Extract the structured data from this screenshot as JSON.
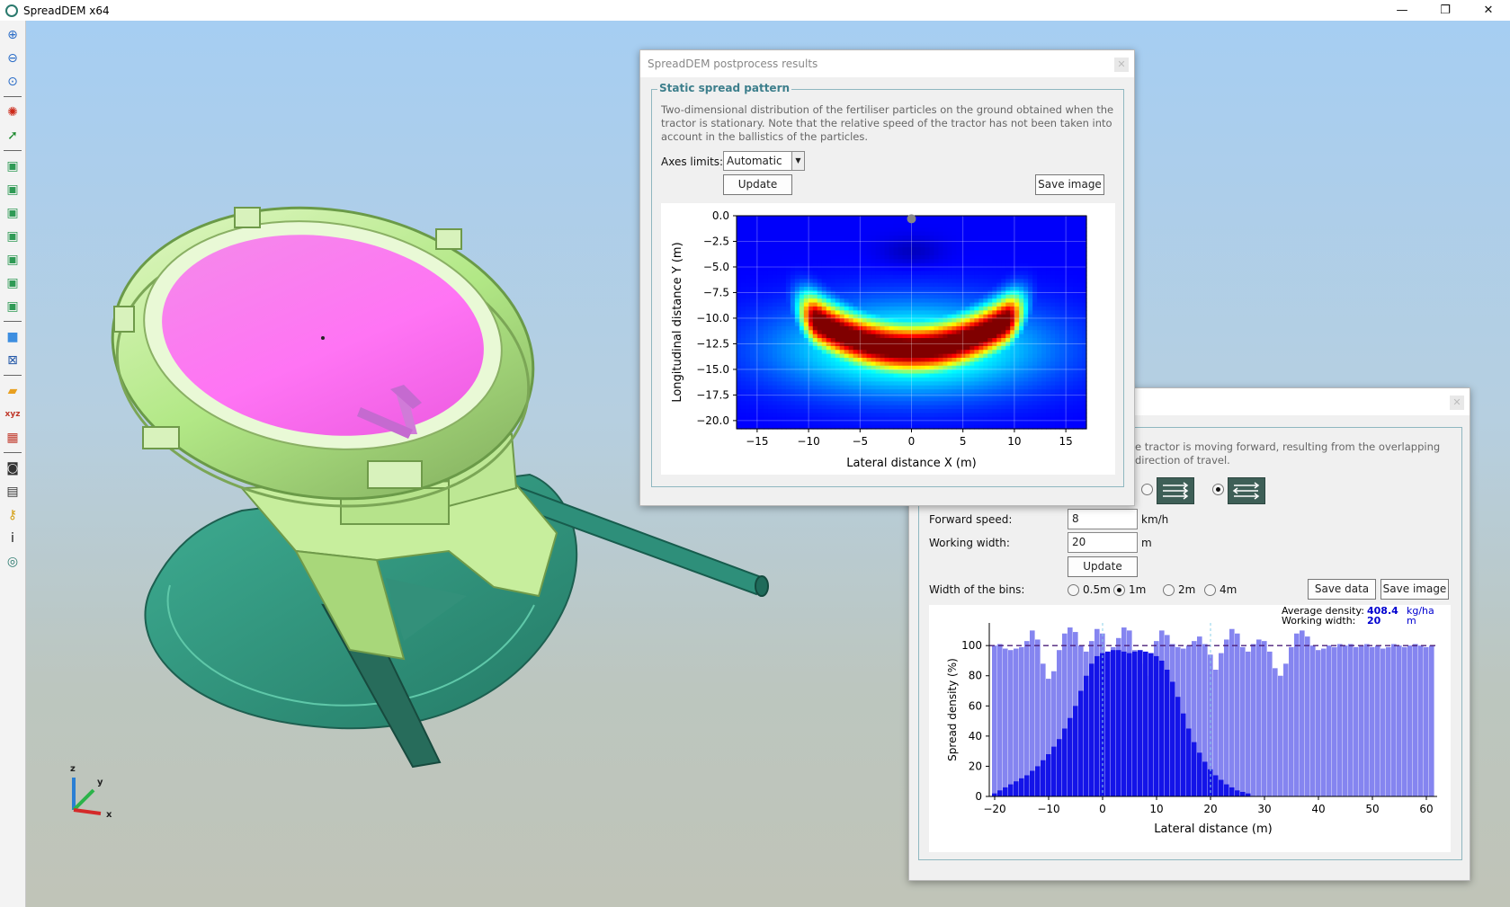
{
  "app": {
    "title": "SpreadDEM x64"
  },
  "window_controls": {
    "minimize": "—",
    "restore": "❐",
    "close": "✕"
  },
  "toolbar": [
    {
      "name": "zoom-in-icon",
      "glyph": "⊕",
      "color": "#2a6cc7"
    },
    {
      "name": "zoom-out-icon",
      "glyph": "⊖",
      "color": "#2a6cc7"
    },
    {
      "name": "zoom-fit-icon",
      "glyph": "⊙",
      "color": "#2a6cc7"
    },
    {
      "name": "rotate-view-icon",
      "glyph": "✺",
      "color": "#cc2a1a"
    },
    {
      "name": "pick-icon",
      "glyph": "➚",
      "color": "#1d8a2f"
    },
    {
      "name": "view-front-icon",
      "glyph": "▣",
      "color": "#2f9a55"
    },
    {
      "name": "view-back-icon",
      "glyph": "▣",
      "color": "#2f9a55"
    },
    {
      "name": "view-left-icon",
      "glyph": "▣",
      "color": "#2f9a55"
    },
    {
      "name": "view-right-icon",
      "glyph": "▣",
      "color": "#2f9a55"
    },
    {
      "name": "view-top-icon",
      "glyph": "▣",
      "color": "#2f9a55"
    },
    {
      "name": "view-bottom-icon",
      "glyph": "▣",
      "color": "#2f9a55"
    },
    {
      "name": "view-iso-icon",
      "glyph": "▣",
      "color": "#2f9a55"
    },
    {
      "name": "shaded-mode-icon",
      "glyph": "■",
      "color": "#3d8ee0"
    },
    {
      "name": "wireframe-mode-icon",
      "glyph": "⊠",
      "color": "#2458a8"
    },
    {
      "name": "measure-icon",
      "glyph": "▰",
      "color": "#e8a020"
    },
    {
      "name": "axes-icon",
      "glyph": "xyz",
      "color": "#c0392b"
    },
    {
      "name": "chart-icon",
      "glyph": "▦",
      "color": "#c0392b"
    },
    {
      "name": "camera-icon",
      "glyph": "◙",
      "color": "#333333"
    },
    {
      "name": "print-icon",
      "glyph": "▤",
      "color": "#333333"
    },
    {
      "name": "key-icon",
      "glyph": "⚷",
      "color": "#d4a017"
    },
    {
      "name": "info-icon",
      "glyph": "i",
      "color": "#111111"
    },
    {
      "name": "spreadem-logo-icon",
      "glyph": "◎",
      "color": "#2b7a6e"
    }
  ],
  "axis_triad": {
    "z": "z",
    "y": "y",
    "x": "x"
  },
  "dialog1": {
    "title": "SpreadDEM postprocess results",
    "close": "✕",
    "group_title": "Static spread pattern",
    "description": "Two-dimensional distribution of the fertiliser particles on the ground obtained when the tractor is stationary. Note that the relative speed of the tractor has not been taken into account in the ballistics of the particles.",
    "axes_limits_label": "Axes limits:",
    "axes_limits_value": "Automatic",
    "update_label": "Update",
    "save_image_label": "Save image"
  },
  "dialog2": {
    "close": "✕",
    "description": "e tractor is moving forward, resulting from the overlapping\ndirection of travel.",
    "forward_speed_label": "Forward speed:",
    "forward_speed_value": "8",
    "forward_speed_unit": "km/h",
    "working_width_label": "Working width:",
    "working_width_value": "20",
    "working_width_unit": "m",
    "update_label": "Update",
    "bins_label": "Width of the bins:",
    "bin_options": [
      "0.5m",
      "1m",
      "2m",
      "4m"
    ],
    "bin_selected": "1m",
    "save_data_label": "Save data",
    "save_image_label": "Save image"
  },
  "colors": {
    "heatmap_bg": "#0a0ad8",
    "bar_light": "#8585f0",
    "bar_dark": "#1414e8",
    "accent_text": "#0000d0",
    "dashed_line": "#4b1f7a"
  },
  "chart_data": [
    {
      "type": "heatmap",
      "title": "",
      "xlabel": "Lateral distance X (m)",
      "ylabel": "Longitudinal distance Y (m)",
      "xlim": [
        -17,
        17
      ],
      "ylim": [
        -20.8,
        0
      ],
      "xticks": [
        -15,
        -10,
        -5,
        0,
        5,
        10,
        15
      ],
      "yticks": [
        0.0,
        -2.5,
        -5.0,
        -7.5,
        -10.0,
        -12.5,
        -15.0,
        -17.5,
        -20.0
      ],
      "colormap": "jet",
      "grid": true,
      "peak_band": {
        "x_range": [
          -9,
          9
        ],
        "y_center": -13,
        "intensity_max": 1.0
      },
      "spreader_point": {
        "x": 0,
        "y": -0.3
      }
    },
    {
      "type": "bar",
      "title": "",
      "xlabel": "Lateral distance (m)",
      "ylabel": "Spread density (%)",
      "xlim": [
        -21,
        62
      ],
      "ylim": [
        0,
        115
      ],
      "xticks": [
        -20,
        -10,
        0,
        10,
        20,
        30,
        40,
        50,
        60
      ],
      "yticks": [
        0,
        20,
        40,
        60,
        80,
        100
      ],
      "bin_width": 1,
      "reference_line": 100,
      "legend_text": {
        "average_density_label": "Average density:",
        "average_density_value": "408.4",
        "average_density_unit": "kg/ha",
        "working_width_label": "Working width:",
        "working_width_value": "20",
        "working_width_unit": "m"
      },
      "series": [
        {
          "name": "overlapped",
          "x_start": -20.5,
          "values": [
            100,
            101,
            98,
            97,
            98,
            99,
            103,
            110,
            104,
            88,
            78,
            83,
            97,
            108,
            112,
            109,
            100,
            96,
            103,
            111,
            108,
            96,
            99,
            105,
            112,
            110,
            97,
            88,
            80,
            95,
            103,
            110,
            107,
            101,
            99,
            98,
            100,
            103,
            106,
            101,
            94,
            84,
            95,
            104,
            111,
            108,
            99,
            96,
            101,
            104,
            103,
            96,
            85,
            80,
            88,
            99,
            108,
            110,
            106,
            100,
            97,
            98,
            100,
            99,
            101,
            100,
            101,
            99,
            100,
            101,
            99,
            100,
            98,
            99,
            101,
            100,
            99,
            100,
            101,
            100,
            99,
            100
          ]
        },
        {
          "name": "single pass",
          "x_start": -20.5,
          "values": [
            2,
            4,
            6,
            8,
            10,
            12,
            14,
            17,
            20,
            24,
            28,
            33,
            38,
            45,
            52,
            60,
            70,
            80,
            88,
            93,
            95,
            96,
            97,
            97,
            96,
            95,
            96,
            97,
            96,
            95,
            93,
            90,
            84,
            76,
            66,
            55,
            45,
            36,
            29,
            23,
            18,
            14,
            11,
            8,
            6,
            4,
            3,
            2
          ]
        }
      ]
    }
  ]
}
